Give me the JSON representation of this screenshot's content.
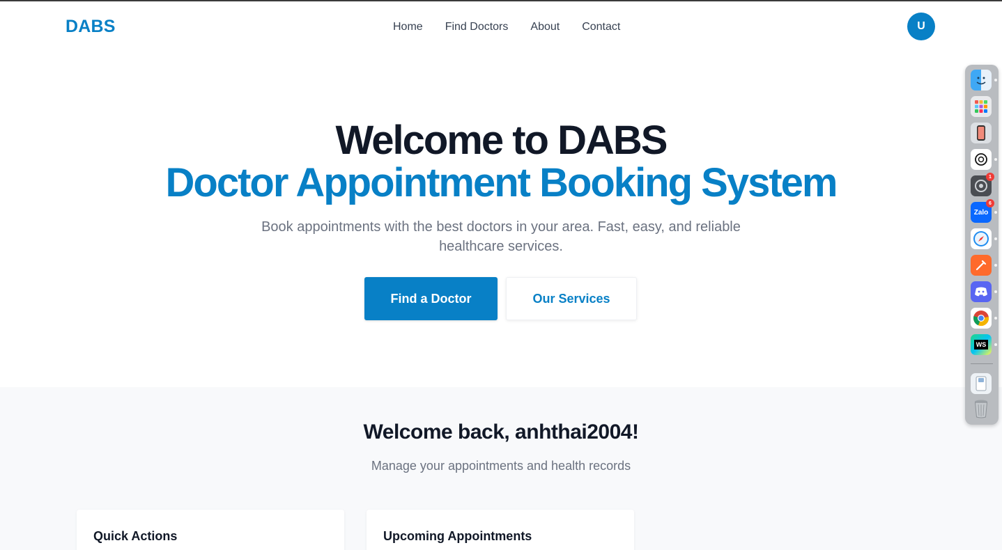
{
  "nav": {
    "logo": "DABS",
    "links": [
      "Home",
      "Find Doctors",
      "About",
      "Contact"
    ],
    "avatar_initial": "U"
  },
  "hero": {
    "title_line1": "Welcome to DABS",
    "title_line2": "Doctor Appointment Booking System",
    "subtitle": "Book appointments with the best doctors in your area. Fast, easy, and reliable healthcare services.",
    "primary_button": "Find a Doctor",
    "secondary_button": "Our Services"
  },
  "dashboard": {
    "greeting": "Welcome back, anhthai2004!",
    "subtitle": "Manage your appointments and health records",
    "cards": [
      "Quick Actions",
      "Upcoming Appointments"
    ]
  },
  "dock": {
    "badges": {
      "chatgpt_settings": "1",
      "zalo": "6"
    },
    "zalo_label": "Zalo",
    "webstorm_label": "WS"
  },
  "colors": {
    "brand": "#0880c6",
    "heading": "#111827",
    "muted": "#6b7280",
    "section_bg": "#f8f9fb"
  }
}
